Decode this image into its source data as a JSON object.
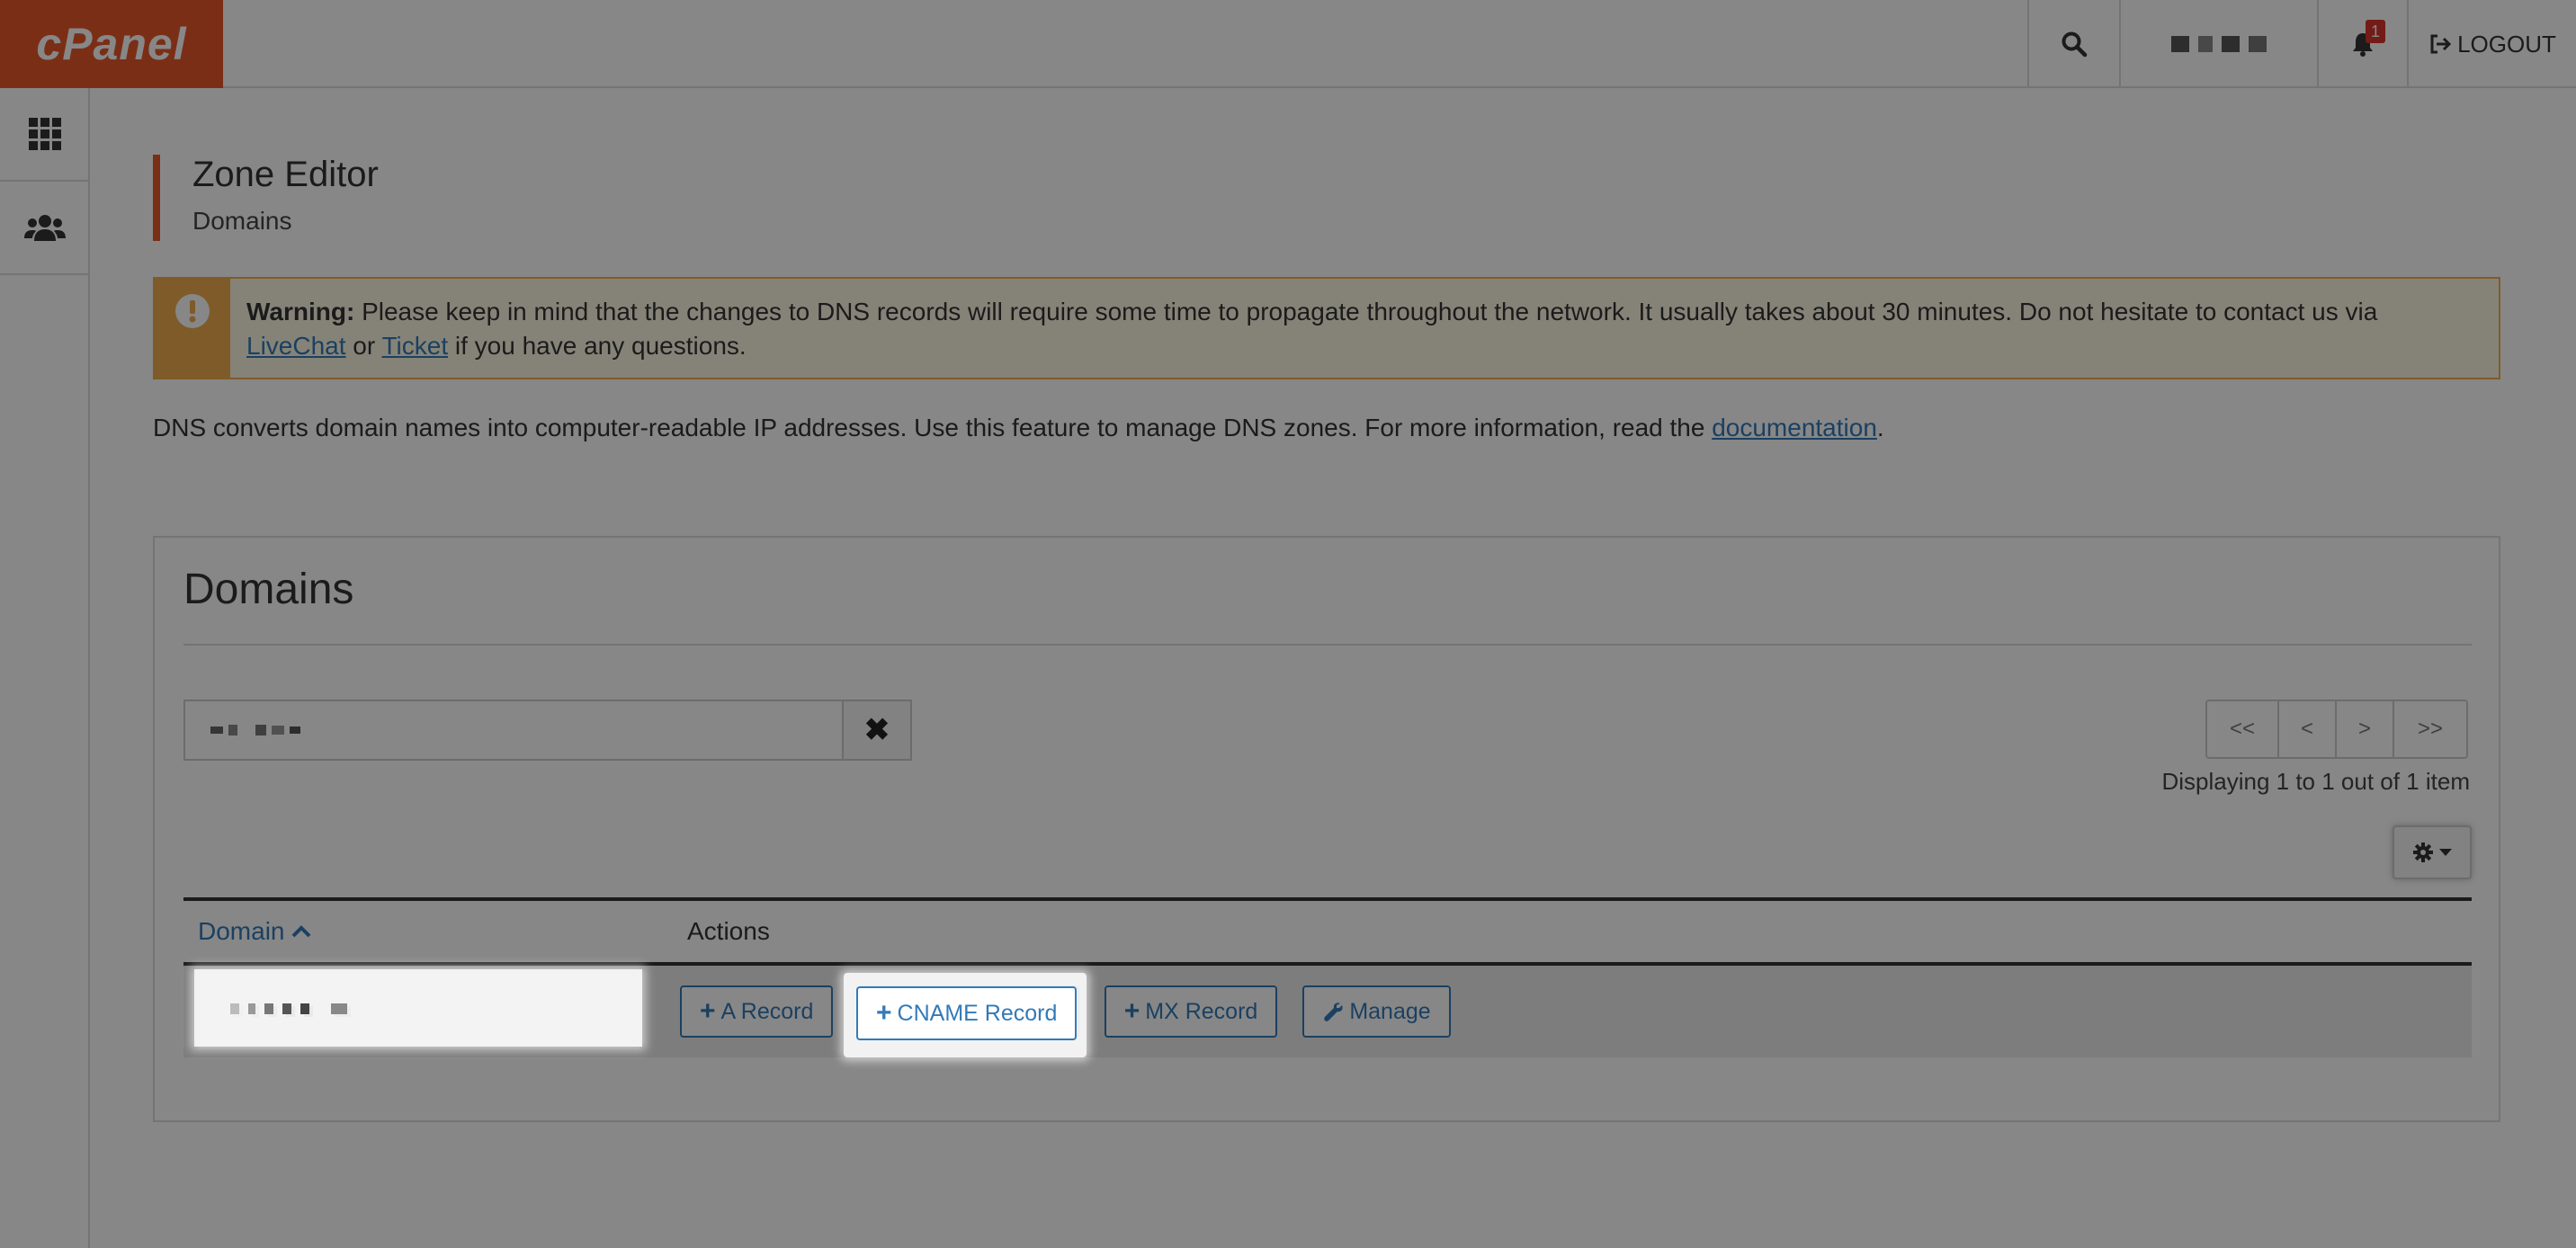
{
  "brand": {
    "logo_text": "cPanel",
    "accent": "#e8572a"
  },
  "topbar": {
    "search_icon": "search-icon",
    "notification_count": "1",
    "logout_label": "LOGOUT"
  },
  "sidebar": {
    "items": [
      {
        "icon": "grid-icon"
      },
      {
        "icon": "users-icon"
      }
    ]
  },
  "page": {
    "title": "Zone Editor",
    "subtitle": "Domains"
  },
  "warning": {
    "label": "Warning:",
    "text": "Please keep in mind that the changes to DNS records will require some time to propagate throughout the network. It usually takes about 30 minutes. Do not hesitate to contact us via",
    "link1": "LiveChat",
    "or": "or",
    "link2": "Ticket",
    "tail": "if you have any questions."
  },
  "intro": {
    "text": "DNS converts domain names into computer-readable IP addresses. Use this feature to manage DNS zones. For more information, read the",
    "link": "documentation",
    "end": "."
  },
  "panel": {
    "title": "Domains",
    "pager": {
      "first": "<<",
      "prev": "<",
      "next": ">",
      "last": ">>"
    },
    "displaying": "Displaying 1 to 1 out of 1 item",
    "table": {
      "col_domain": "Domain",
      "col_actions": "Actions",
      "actions": {
        "a_record": "A Record",
        "cname_record": "CNAME Record",
        "mx_record": "MX Record",
        "manage": "Manage"
      }
    }
  }
}
